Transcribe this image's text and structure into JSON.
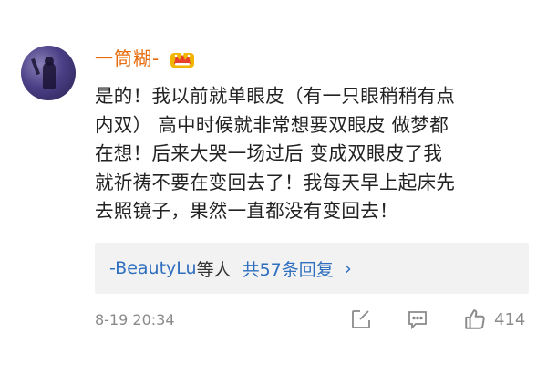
{
  "comment": {
    "username": "一筒糊-",
    "badge_icon": "crown-badge-icon",
    "lines": [
      "是的！我以前就单眼皮（有一只眼稍稍有点",
      "内双） 高中时候就非常想要双眼皮 做梦都",
      "在想！后来大哭一场过后 变成双眼皮了我",
      "就祈祷不要在变回去了！我每天早上起床先",
      "去照镜子，果然一直都没有变回去！"
    ],
    "replies": {
      "user": "-BeautyLu",
      "suffix": "等人",
      "count_text": "共57条回复",
      "chevron": "›"
    },
    "timestamp": "8-19 20:34",
    "actions": {
      "repost_icon": "edit-repost-icon",
      "comment_icon": "comment-icon",
      "like_icon": "thumbs-up-icon",
      "like_count": "414"
    }
  },
  "colors": {
    "username": "#e86b0c",
    "link": "#2e6fbf",
    "text": "#222222",
    "muted": "#8a8a8a",
    "reply_bg": "#f2f2f2"
  }
}
